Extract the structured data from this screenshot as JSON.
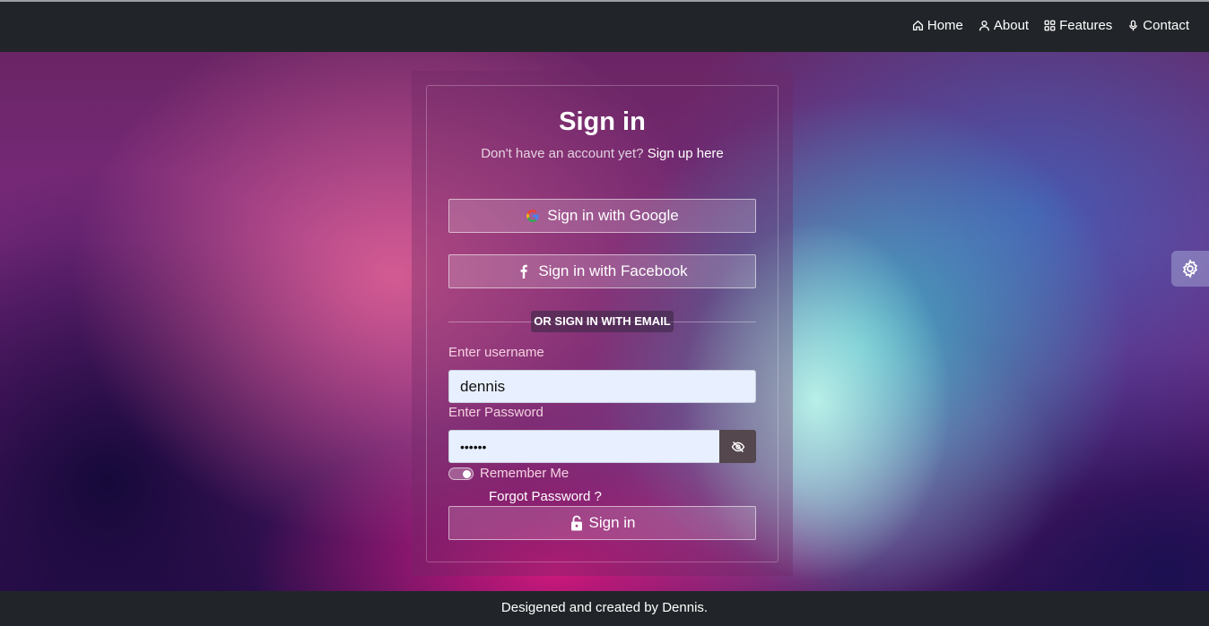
{
  "nav": {
    "items": [
      {
        "label": "Home",
        "icon": "home-icon"
      },
      {
        "label": "About",
        "icon": "user-icon"
      },
      {
        "label": "Features",
        "icon": "grid-icon"
      },
      {
        "label": "Contact",
        "icon": "microphone-icon"
      }
    ]
  },
  "login": {
    "title": "Sign in",
    "subtitle_prefix": "Don't have an account yet?",
    "signup_link": "Sign up here",
    "google_label": "Sign in with Google",
    "facebook_label": "Sign in with Facebook",
    "divider": "OR SIGN IN WITH EMAIL",
    "username_label": "Enter username",
    "username_value": "dennis",
    "password_label": "Enter Password",
    "password_value": "dennis",
    "remember_label": "Remember Me",
    "remember_checked": true,
    "forgot_label": "Forgot Password ?",
    "submit_label": "Sign in"
  },
  "footer": {
    "text": "Desigened and created by Dennis."
  },
  "colors": {
    "navbar": "#212529",
    "input_bg": "#e8effe",
    "eye_button": "#54474d"
  }
}
